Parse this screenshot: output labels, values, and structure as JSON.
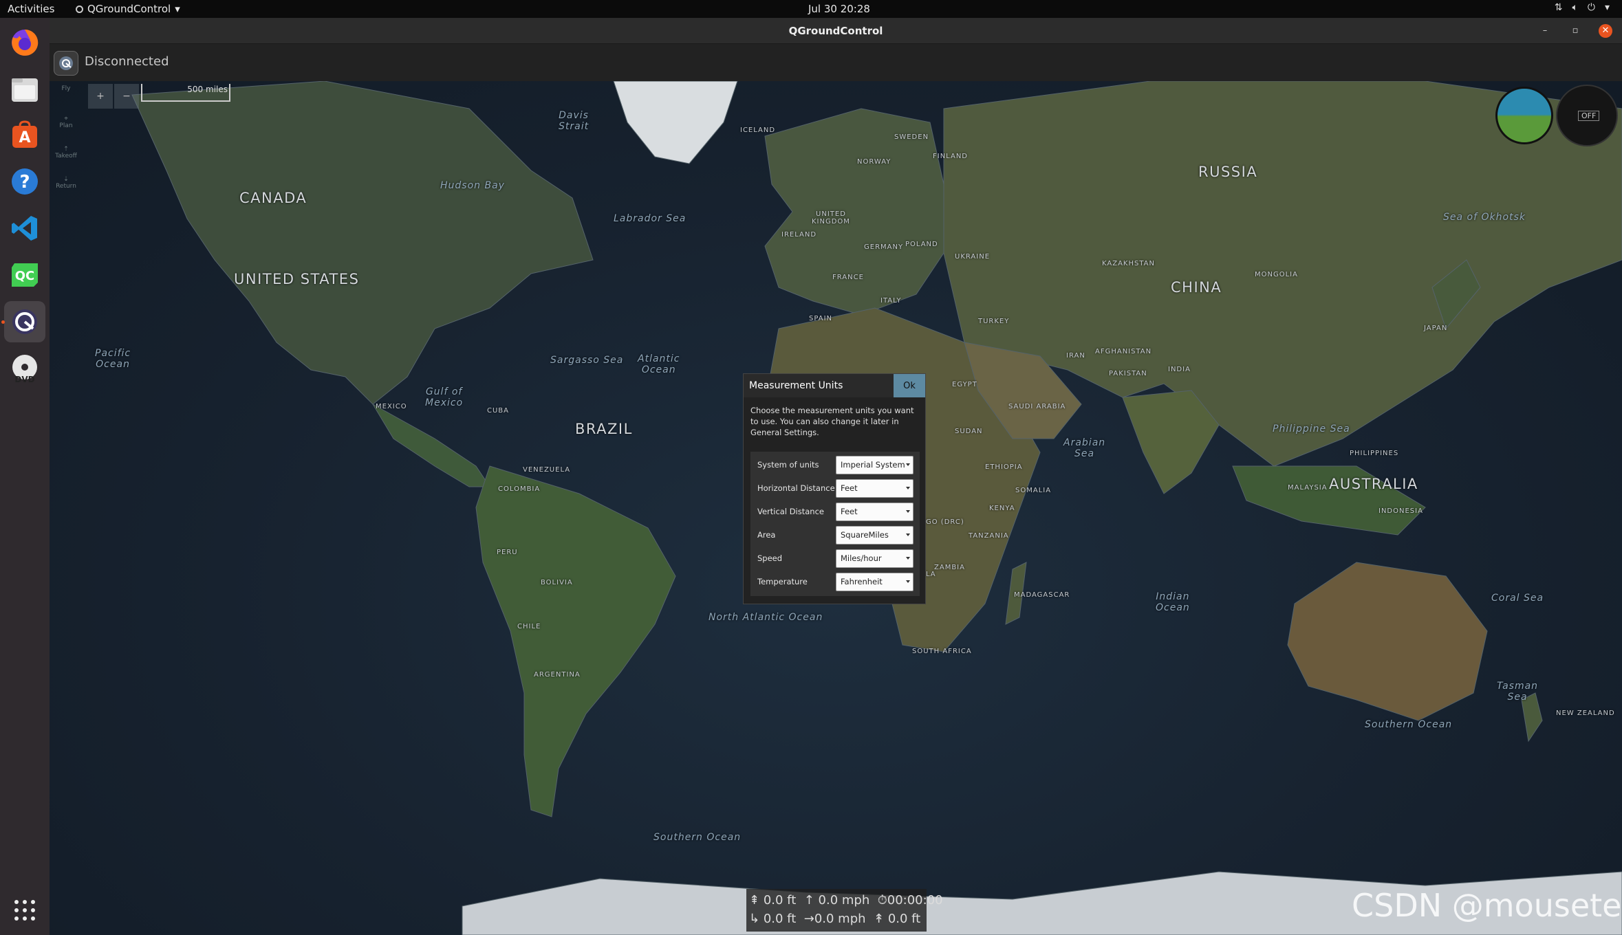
{
  "topbar": {
    "activities": "Activities",
    "app_name": "QGroundControl",
    "clock": "Jul 30  20:28",
    "tray": [
      "network-icon",
      "volume-icon",
      "power-icon"
    ]
  },
  "dock": {
    "apps": [
      "firefox",
      "files",
      "app-center",
      "help",
      "vscode",
      "qt-creator",
      "qgroundcontrol",
      "dvd"
    ]
  },
  "window": {
    "title": "QGroundControl",
    "controls": [
      "–",
      "▫",
      "✕"
    ]
  },
  "toolbar": {
    "status": "Disconnected"
  },
  "plan_tools": {
    "fly": "Fly",
    "plan": "Plan",
    "takeoff": "Takeoff",
    "return": "Return"
  },
  "map": {
    "zoom_in": "+",
    "zoom_out": "−",
    "scale": "500 miles",
    "labels": {
      "canada": "CANADA",
      "united_states": "UNITED STATES",
      "russia": "RUSSIA",
      "china": "CHINA",
      "brazil": "BRAZIL",
      "australia": "AUSTRALIA",
      "pacific": "Pacific\nOcean",
      "atlantic": "Atlantic\nOcean",
      "north_atlantic": "North Atlantic Ocean",
      "indian": "Indian\nOcean",
      "southern_ocean_1": "Southern Ocean",
      "southern_ocean_2": "Southern Ocean",
      "hudson_bay": "Hudson Bay",
      "labrador_sea": "Labrador Sea",
      "davis_strait": "Davis\nStrait",
      "sargasso_sea": "Sargasso Sea",
      "gulf_mexico": "Gulf of\nMexico",
      "arabian_sea": "Arabian\nSea",
      "philippine_sea": "Philippine Sea",
      "sea_okhotsk": "Sea of Okhotsk",
      "coral_sea": "Coral Sea",
      "tasman_sea": "Tasman\nSea",
      "kazakhstan": "KAZAKHSTAN",
      "mongolia": "MONGOLIA",
      "india": "INDIA",
      "mexico": "MEXICO",
      "colombia": "COLOMBIA",
      "peru": "PERU",
      "argentina": "ARGENTINA",
      "indonesia": "INDONESIA",
      "iran": "IRAN",
      "egypt": "EGYPT",
      "sudan": "SUDAN",
      "turkey": "TURKEY",
      "france": "FRANCE",
      "finland": "FINLAND",
      "norway": "NORWAY",
      "sweden": "SWEDEN",
      "iceland": "ICELAND",
      "japan": "JAPAN",
      "bolivia": "BOLIVIA",
      "chile": "CHILE",
      "venezuela": "VENEZUELA",
      "cuba": "CUBA",
      "madagascar": "MADAGASCAR",
      "new_zealand": "NEW ZEALAND",
      "south_africa": "SOUTH AFRICA",
      "philippines": "PHILIPPINES",
      "malaysia": "MALAYSIA",
      "ethiopia": "ETHIOPIA",
      "somalia": "SOMALIA",
      "saudi_arabia": "SAUDI ARABIA",
      "pakistan": "PAKISTAN",
      "afghanistan": "AFGHANISTAN",
      "ukraine": "UKRAINE",
      "poland": "POLAND",
      "germany": "GERMANY",
      "italy": "ITALY",
      "spain": "SPAIN",
      "united_kingdom": "UNITED\nKINGDOM",
      "ireland": "IRELAND",
      "tanzania": "TANZANIA",
      "zambia": "ZAMBIA",
      "kenya": "KENYA",
      "angola": "ANGOLA",
      "dr_congo": "GO (DRC)"
    }
  },
  "instruments": {
    "compass_off": "OFF"
  },
  "dialog": {
    "title": "Measurement Units",
    "ok": "Ok",
    "description": "Choose the measurement units you want to use. You can also change it later in General Settings.",
    "rows": [
      {
        "label": "System of units",
        "value": "Imperial System"
      },
      {
        "label": "Horizontal Distance",
        "value": "Feet"
      },
      {
        "label": "Vertical Distance",
        "value": "Feet"
      },
      {
        "label": "Area",
        "value": "SquareMiles"
      },
      {
        "label": "Speed",
        "value": "Miles/hour"
      },
      {
        "label": "Temperature",
        "value": "Fahrenheit"
      }
    ]
  },
  "telemetry": {
    "altitude": "0.0 ft",
    "climb_speed": "0.0 mph",
    "flight_time": "00:00:00",
    "distance_home": "0.0 ft",
    "ground_speed": "0.0 mph",
    "altitude_rel": "0.0 ft"
  },
  "watermark": "CSDN @mousetest"
}
